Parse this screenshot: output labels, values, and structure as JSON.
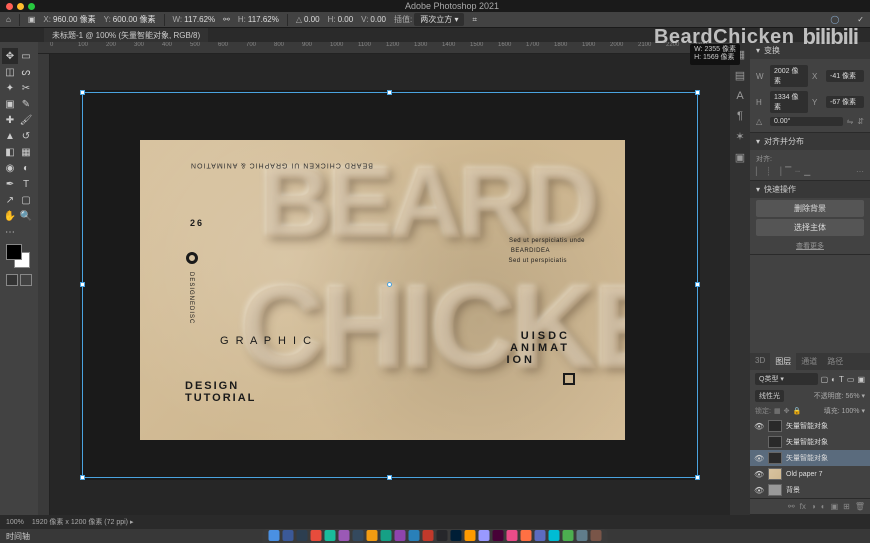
{
  "app": {
    "title": "Adobe Photoshop 2021"
  },
  "watermark": {
    "text": "BeardChicken",
    "logo": "bilibili"
  },
  "dim_tooltip": {
    "w_label": "W:",
    "w_val": "2355 像素",
    "h_label": "H:",
    "h_val": "1569 像素"
  },
  "options_bar": {
    "x_label": "X:",
    "x_val": "960.00 像素",
    "y_label": "Y:",
    "y_val": "600.00 像素",
    "w_label": "W:",
    "w_val": "117.62%",
    "h_label": "H:",
    "h_val": "117.62%",
    "angle_label": "△",
    "angle_val": "0.00",
    "hsk_label": "H:",
    "hsk_val": "0.00",
    "vsk_label": "V:",
    "vsk_val": "0.00",
    "interp_label": "插值:",
    "interp_val": "两次立方 ▾",
    "commit": "✓",
    "cancel": "◯"
  },
  "doc_tab": {
    "label": "未标题-1 @ 100% (矢量智能对象, RGB/8)"
  },
  "ruler_ticks": [
    "0",
    "100",
    "200",
    "300",
    "400",
    "500",
    "600",
    "700",
    "800",
    "900",
    "1000",
    "1100",
    "1200",
    "1300",
    "1400",
    "1500",
    "1600",
    "1700",
    "1800",
    "1900",
    "2000",
    "2100",
    "2200",
    "2300"
  ],
  "tools": [
    {
      "name": "move",
      "g": "✥"
    },
    {
      "name": "artboard",
      "g": "▭"
    },
    {
      "name": "marquee",
      "g": "◫"
    },
    {
      "name": "lasso",
      "g": "ᔕ"
    },
    {
      "name": "wand",
      "g": "✦"
    },
    {
      "name": "crop",
      "g": "✂"
    },
    {
      "name": "frame",
      "g": "▣"
    },
    {
      "name": "eyedropper",
      "g": "✎"
    },
    {
      "name": "healing",
      "g": "✚"
    },
    {
      "name": "brush",
      "g": "🖌"
    },
    {
      "name": "stamp",
      "g": "▲"
    },
    {
      "name": "history",
      "g": "↺"
    },
    {
      "name": "eraser",
      "g": "◧"
    },
    {
      "name": "gradient",
      "g": "▦"
    },
    {
      "name": "blur",
      "g": "◉"
    },
    {
      "name": "dodge",
      "g": "◐"
    },
    {
      "name": "pen",
      "g": "✒"
    },
    {
      "name": "type",
      "g": "T"
    },
    {
      "name": "path",
      "g": "↗"
    },
    {
      "name": "shape",
      "g": "▢"
    },
    {
      "name": "hand",
      "g": "✋"
    },
    {
      "name": "zoom",
      "g": "🔍"
    },
    {
      "name": "more",
      "g": "⋯"
    }
  ],
  "iconstrip": [
    {
      "name": "color",
      "g": "▦"
    },
    {
      "name": "swatches",
      "g": "▤"
    },
    {
      "name": "char",
      "g": "A"
    },
    {
      "name": "para",
      "g": "¶"
    },
    {
      "name": "actions",
      "g": "✶"
    },
    {
      "name": "styles",
      "g": "▣"
    }
  ],
  "properties": {
    "title": "变换",
    "w_label": "W",
    "w_val": "2002 像素",
    "x_label": "X",
    "x_val": "-41 像素",
    "h_label": "H",
    "h_val": "1334 像素",
    "y_label": "Y",
    "y_val": "-67 像素",
    "angle_label": "△",
    "angle_val": "0.00°"
  },
  "align": {
    "title": "对齐并分布",
    "sub": "对齐:"
  },
  "quick_actions": {
    "title": "快速操作",
    "btn1": "删除背景",
    "btn2": "选择主体",
    "more": "查看更多"
  },
  "layers_panel": {
    "tabs": [
      "3D",
      "图层",
      "通道",
      "路径"
    ],
    "active_tab": 1,
    "filter_label": "Q类型 ▾",
    "blend_mode": "线性光",
    "opacity_label": "不透明度:",
    "opacity_val": "56% ▾",
    "lock_label": "锁定:",
    "fill_label": "填充:",
    "fill_val": "100% ▾",
    "layers": [
      {
        "name": "矢量智能对象",
        "visible": true,
        "kind": "smart",
        "sel": false
      },
      {
        "name": "矢量智能对象",
        "visible": false,
        "kind": "smart",
        "sel": false
      },
      {
        "name": "矢量智能对象",
        "visible": true,
        "kind": "smart",
        "sel": true
      },
      {
        "name": "Old paper 7",
        "visible": true,
        "kind": "paper",
        "sel": false
      },
      {
        "name": "背景",
        "visible": true,
        "kind": "bg",
        "sel": false
      }
    ]
  },
  "status": {
    "zoom": "100%",
    "info": "1920 像素 x 1200 像素 (72 ppi)  ▸"
  },
  "timeline": {
    "label": "时间轴"
  },
  "artwork": {
    "emboss1": "BEARD",
    "emboss2": "CHICKEN",
    "num": "26",
    "side": "BEARD\nCHICKEN UI\nGRAPHIC &\nANIMATION",
    "vert": "DESIGNEDISC",
    "graphic": "G R A P H I C",
    "design": "DESIGN",
    "tutorial": "TUTORIAL",
    "uisdc": "UISDC",
    "animat": "ANIMAT",
    "ion": "ION",
    "lorem1": "Sed ut perspiciatis unde",
    "lorem2": "BEARDIDEA",
    "lorem3": "Sed ut perspiciatis"
  },
  "dock_colors": [
    "#4a90e2",
    "#3b5998",
    "#2c3e50",
    "#e74c3c",
    "#1abc9c",
    "#9b59b6",
    "#34495e",
    "#f39c12",
    "#16a085",
    "#8e44ad",
    "#2980b9",
    "#c0392b",
    "#26272b",
    "#001e36",
    "#ff9a00",
    "#9999ff",
    "#470137",
    "#ea4c89",
    "#ff7043",
    "#5c6bc0",
    "#00bcd4",
    "#4caf50",
    "#607d8b",
    "#795548"
  ]
}
